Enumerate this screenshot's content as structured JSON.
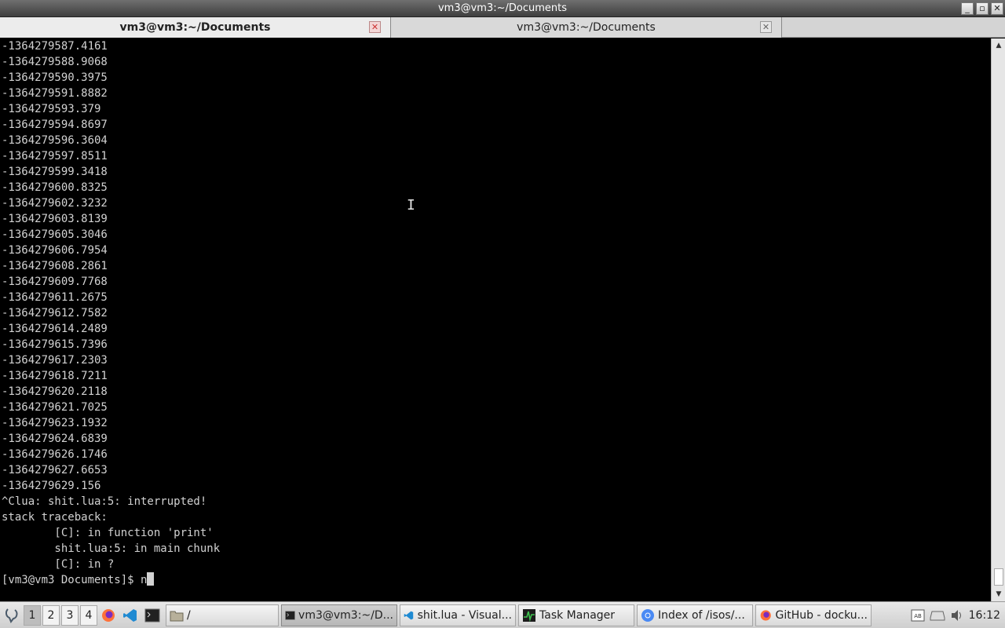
{
  "window": {
    "title": "vm3@vm3:~/Documents",
    "controls": [
      "_",
      "▫",
      "✕"
    ]
  },
  "tabs": [
    {
      "label": "vm3@vm3:~/Documents",
      "active": true
    },
    {
      "label": "vm3@vm3:~/Documents",
      "active": false
    }
  ],
  "terminal": {
    "lines": [
      "-1364279587.4161",
      "-1364279588.9068",
      "-1364279590.3975",
      "-1364279591.8882",
      "-1364279593.379",
      "-1364279594.8697",
      "-1364279596.3604",
      "-1364279597.8511",
      "-1364279599.3418",
      "-1364279600.8325",
      "-1364279602.3232",
      "-1364279603.8139",
      "-1364279605.3046",
      "-1364279606.7954",
      "-1364279608.2861",
      "-1364279609.7768",
      "-1364279611.2675",
      "-1364279612.7582",
      "-1364279614.2489",
      "-1364279615.7396",
      "-1364279617.2303",
      "-1364279618.7211",
      "-1364279620.2118",
      "-1364279621.7025",
      "-1364279623.1932",
      "-1364279624.6839",
      "-1364279626.1746",
      "-1364279627.6653",
      "-1364279629.156",
      "^Clua: shit.lua:5: interrupted!",
      "stack traceback:",
      "        [C]: in function 'print'",
      "        shit.lua:5: in main chunk",
      "        [C]: in ?"
    ],
    "prompt": "[vm3@vm3 Documents]$ ",
    "input": "n"
  },
  "taskbar": {
    "workspaces": [
      "1",
      "2",
      "3",
      "4"
    ],
    "active_workspace": "1",
    "launchers": [
      "firefox-icon",
      "vscode-icon",
      "terminal-icon"
    ],
    "tasks": [
      {
        "icon": "folder-icon",
        "label": "/"
      },
      {
        "icon": "terminal-icon",
        "label": "vm3@vm3:~/D..."
      },
      {
        "icon": "vscode-icon",
        "label": "shit.lua - Visual..."
      },
      {
        "icon": "task-manager-icon",
        "label": "Task Manager"
      },
      {
        "icon": "chromium-icon",
        "label": "Index of /isos/..."
      },
      {
        "icon": "firefox-icon",
        "label": "GitHub - docku..."
      }
    ],
    "clock": "16:12"
  },
  "colors": {
    "terminal_bg": "#000000",
    "terminal_fg": "#d2d2d2",
    "firefox": "#ff7139",
    "vscode": "#1f8ad2",
    "chromium": "#4a8af4",
    "task_manager": "#2e8b3a"
  }
}
